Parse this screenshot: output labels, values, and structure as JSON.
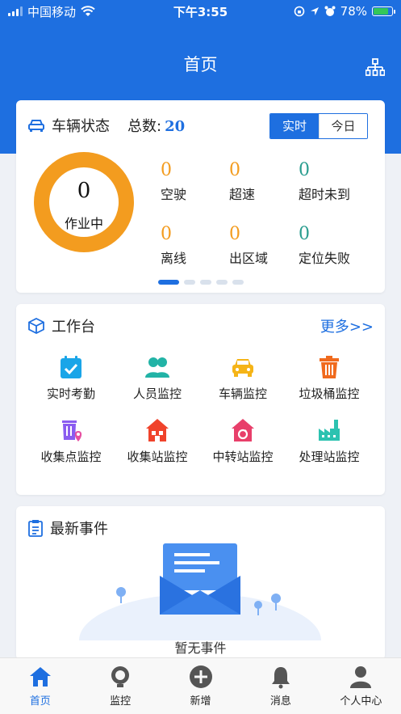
{
  "status_bar": {
    "carrier": "中国移动",
    "time": "下午3:55",
    "battery": "78%",
    "icons": [
      "signal-icon",
      "wifi-icon",
      "lock-rotation-icon",
      "location-icon",
      "alarm-icon",
      "battery-icon"
    ]
  },
  "header": {
    "title": "首页",
    "right_icon": "org-chart-icon"
  },
  "vehicle": {
    "title": "车辆状态",
    "total_label": "总数:",
    "total_value": "20",
    "toggle": [
      "实时",
      "今日"
    ],
    "toggle_selected": "实时",
    "donut_value": "0",
    "donut_label": "作业中",
    "stats": [
      {
        "value": "0",
        "label": "空驶",
        "color": "#f39c1f"
      },
      {
        "value": "0",
        "label": "超速",
        "color": "#f39c1f"
      },
      {
        "value": "0",
        "label": "超时未到",
        "color": "#2a9d8f"
      },
      {
        "value": "0",
        "label": "离线",
        "color": "#f39c1f"
      },
      {
        "value": "0",
        "label": "出区域",
        "color": "#f39c1f"
      },
      {
        "value": "0",
        "label": "定位失败",
        "color": "#2a9d8f"
      }
    ],
    "pager_count": 5,
    "pager_active": 1
  },
  "workbench": {
    "title": "工作台",
    "more": "更多>>",
    "items": [
      {
        "label": "实时考勤",
        "icon": "calendar-check-icon"
      },
      {
        "label": "人员监控",
        "icon": "people-icon"
      },
      {
        "label": "车辆监控",
        "icon": "car-icon"
      },
      {
        "label": "垃圾桶监控",
        "icon": "trash-bin-icon"
      },
      {
        "label": "收集点监控",
        "icon": "collection-point-icon"
      },
      {
        "label": "收集站监控",
        "icon": "collection-station-icon"
      },
      {
        "label": "中转站监控",
        "icon": "transfer-station-icon"
      },
      {
        "label": "处理站监控",
        "icon": "factory-icon"
      }
    ]
  },
  "events": {
    "title": "最新事件",
    "empty_text": "暂无事件"
  },
  "tabbar": [
    {
      "label": "首页",
      "icon": "home-icon",
      "active": true
    },
    {
      "label": "监控",
      "icon": "monitor-icon",
      "active": false
    },
    {
      "label": "新增",
      "icon": "add-icon",
      "active": false
    },
    {
      "label": "消息",
      "icon": "bell-icon",
      "active": false
    },
    {
      "label": "个人中心",
      "icon": "person-icon",
      "active": false
    }
  ],
  "colors": {
    "primary": "#1e6fe0",
    "orange": "#f39c1f",
    "teal": "#2a9d8f"
  }
}
